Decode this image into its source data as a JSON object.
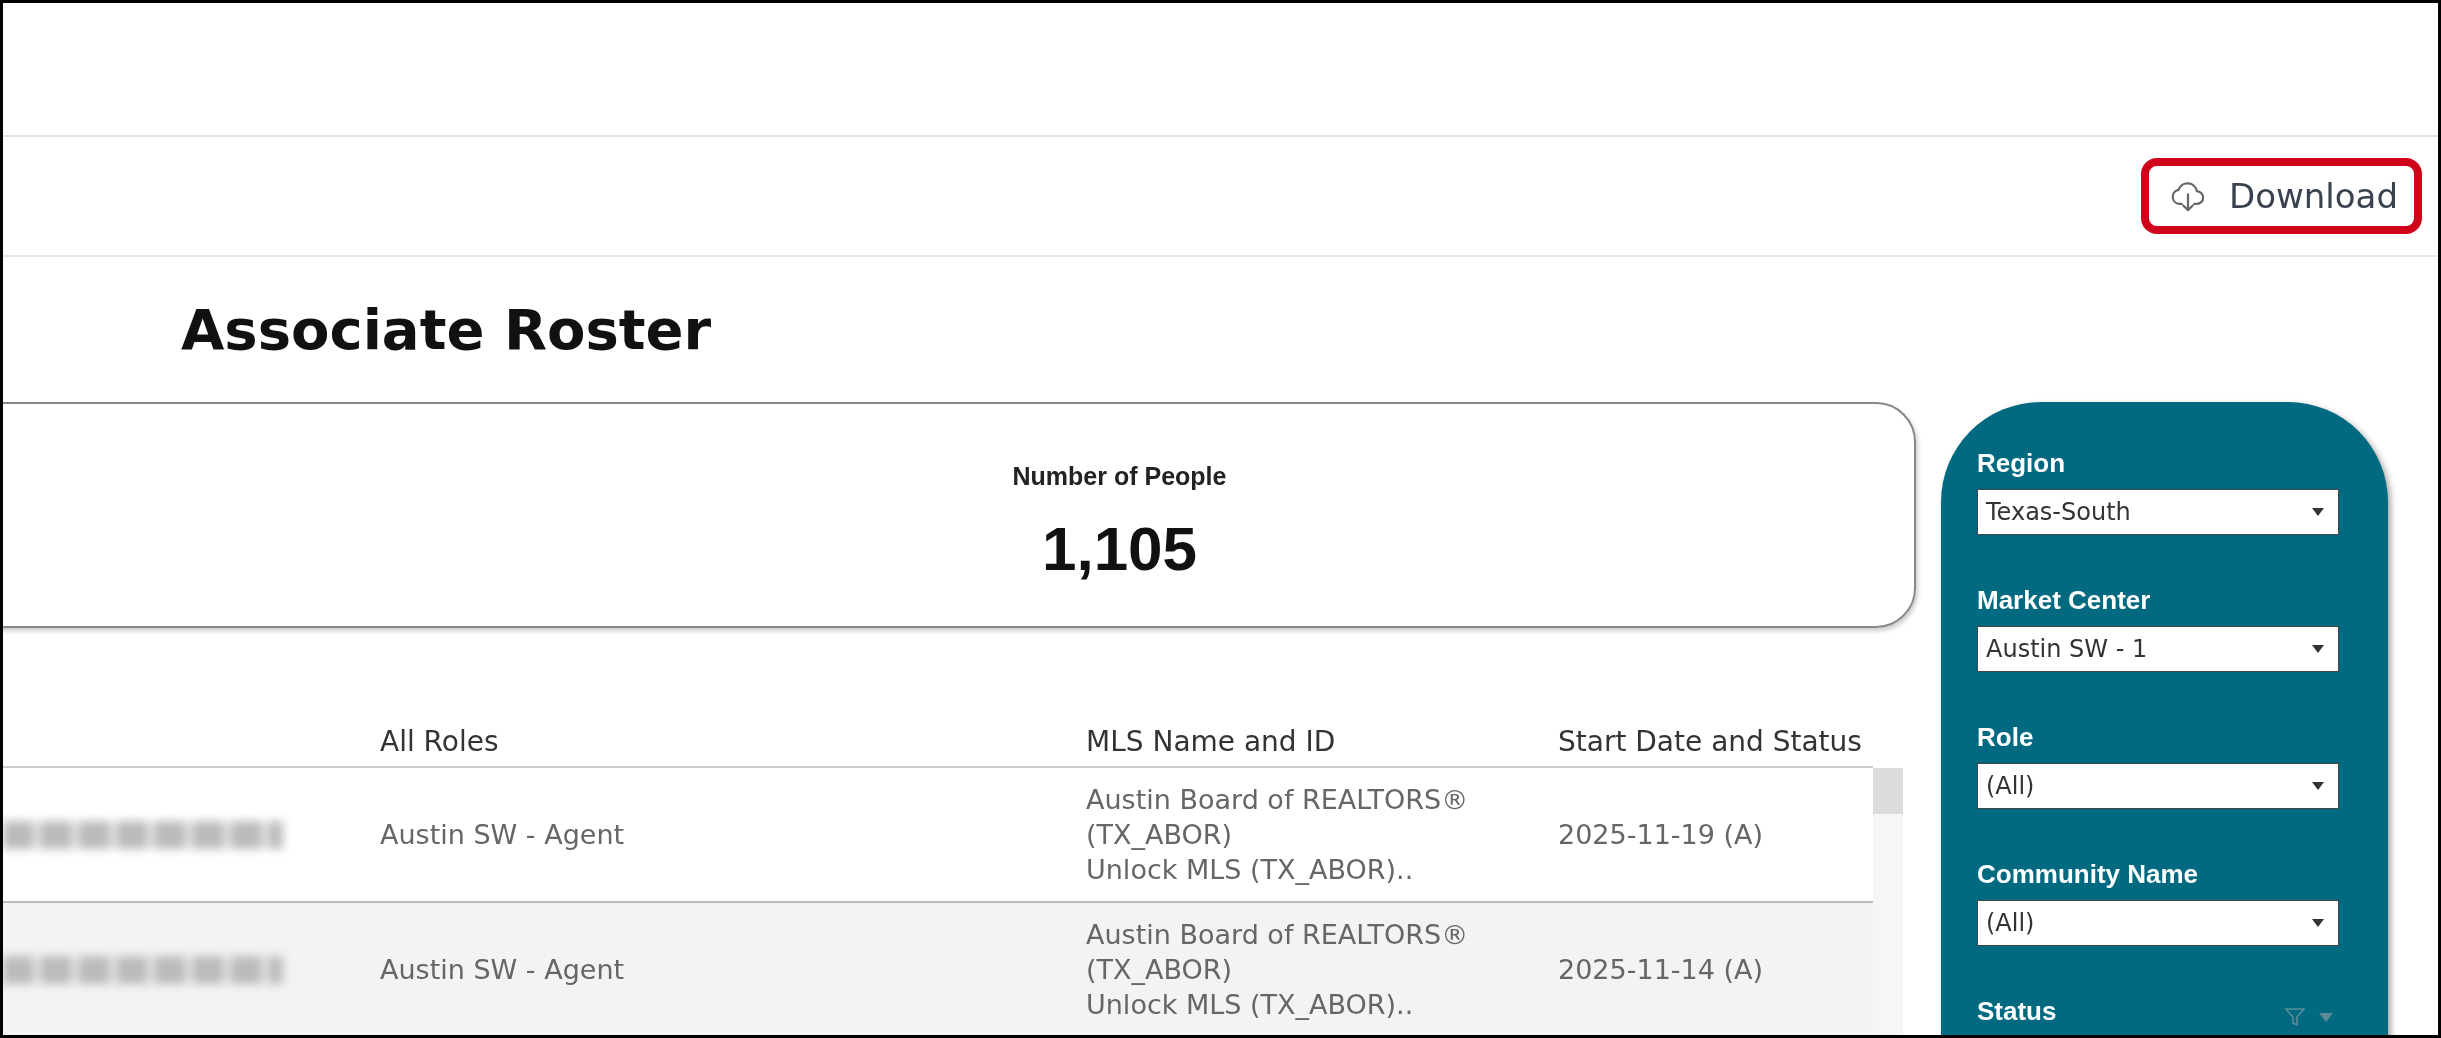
{
  "toolbar": {
    "download_button": {
      "label": "Download",
      "highlighted": true
    }
  },
  "title": "Associate Roster",
  "kpi": {
    "label": "Number of People",
    "value": "1,105"
  },
  "table": {
    "columns": [
      "All Roles",
      "MLS Name and ID",
      "Start Date and Status"
    ],
    "rows": [
      {
        "role": "Austin SW - Agent",
        "mls": "Austin Board of REALTORS®\n(TX_ABOR)\nUnlock MLS (TX_ABOR)..",
        "start": "2025-11-19 (A)",
        "shaded": false
      },
      {
        "role": "Austin SW - Agent",
        "mls": "Austin Board of REALTORS®\n(TX_ABOR)\nUnlock MLS (TX_ABOR)..",
        "start": "2025-11-14 (A)",
        "shaded": true
      }
    ]
  },
  "filters": [
    {
      "kind": "dropdown",
      "label": "Region",
      "value": "Texas-South"
    },
    {
      "kind": "dropdown",
      "label": "Market Center",
      "value": "Austin SW - 1"
    },
    {
      "kind": "dropdown",
      "label": "Role",
      "value": "(All)"
    },
    {
      "kind": "dropdown",
      "label": "Community Name",
      "value": "(All)"
    },
    {
      "kind": "collapsed",
      "label": "Status"
    }
  ]
}
